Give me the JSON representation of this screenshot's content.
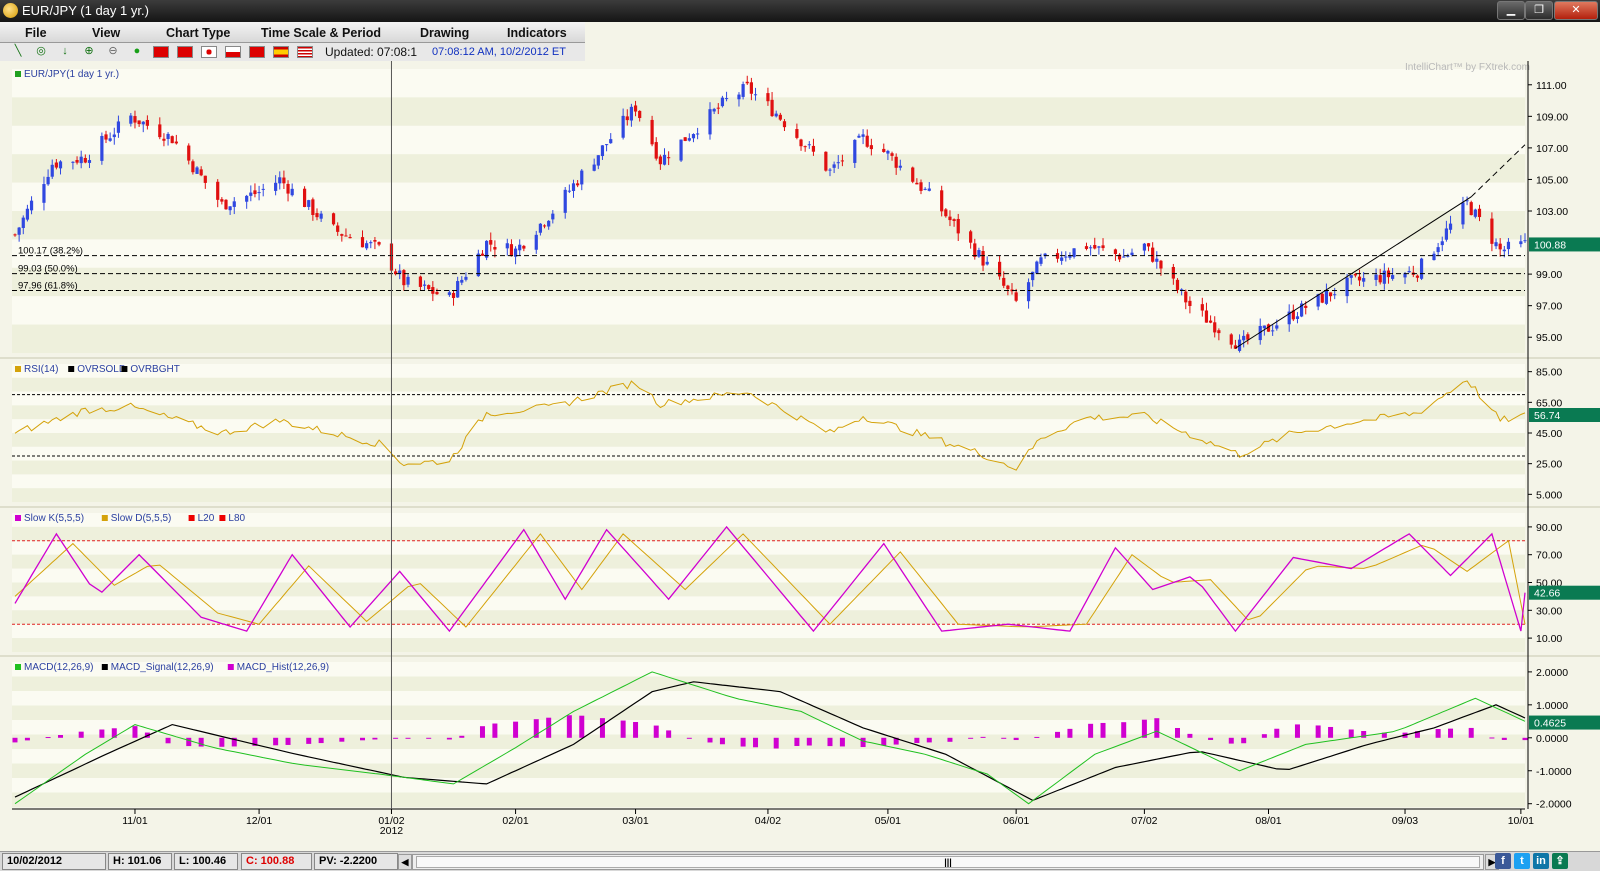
{
  "window": {
    "title": "EUR/JPY (1 day  1 yr.)",
    "min_glyph": "▁",
    "max_glyph": "❐",
    "close_glyph": "✕"
  },
  "menu": [
    "File",
    "View",
    "Chart Type",
    "Time Scale & Period",
    "Drawing",
    "Indicators"
  ],
  "toolbar": {
    "icons": [
      "line-draw-icon",
      "crosshair-icon",
      "arrow-down-icon",
      "zoom-in-icon",
      "zoom-out-icon",
      "green-dot-icon"
    ],
    "flags": [
      "china-flag-icon",
      "hongkong-flag-icon",
      "japan-flag-icon",
      "poland-flag-icon",
      "turkey-flag-icon",
      "spain-flag-icon",
      "usa-flag-icon"
    ],
    "updated_label": "Updated: 07:08:1",
    "updated_time": "07:08:12 AM, 10/2/2012 ET"
  },
  "watermark": "IntelliChart™ by FXtrek.com",
  "colors": {
    "up_candle": "#3048e0",
    "down_candle": "#e01010",
    "rsi": "#d4a20a",
    "slow_k": "#d000d0",
    "slow_d": "#d4a20a",
    "macd": "#20c020",
    "macd_signal": "#000000",
    "macd_hist": "#d000d0",
    "last_value_box": "#0a7a52"
  },
  "xaxis": {
    "labels": [
      "11/01",
      "12/01",
      "01/02",
      "02/01",
      "03/01",
      "04/02",
      "05/01",
      "06/01",
      "07/02",
      "08/01",
      "09/03",
      "10/01"
    ],
    "year_label": "2012"
  },
  "chart_data": [
    {
      "type": "candlestick",
      "legend": [
        "EUR/JPY(1 day  1 yr.)"
      ],
      "x_start": "2011-10-03",
      "x_end": "2012-10-02",
      "ylim": [
        94,
        112
      ],
      "yticks": [
        "111.00",
        "109.00",
        "107.00",
        "105.00",
        "103.00",
        "99.00",
        "97.00",
        "95.00"
      ],
      "last_value": "100.88",
      "anchors": [
        [
          "2011-10-03",
          101.5
        ],
        [
          "2011-10-12",
          106.0
        ],
        [
          "2011-10-20",
          106.4
        ],
        [
          "2011-10-31",
          109.0
        ],
        [
          "2011-11-10",
          107.6
        ],
        [
          "2011-11-22",
          103.4
        ],
        [
          "2011-12-01",
          104.2
        ],
        [
          "2011-12-06",
          105.0
        ],
        [
          "2011-12-19",
          101.8
        ],
        [
          "2011-12-30",
          100.6
        ],
        [
          "2012-01-05",
          98.5
        ],
        [
          "2012-01-16",
          97.5
        ],
        [
          "2012-01-25",
          101.0
        ],
        [
          "2012-02-01",
          100.5
        ],
        [
          "2012-02-10",
          103.0
        ],
        [
          "2012-03-01",
          109.6
        ],
        [
          "2012-03-07",
          106.2
        ],
        [
          "2012-03-23",
          110.0
        ],
        [
          "2012-03-28",
          110.8
        ],
        [
          "2012-04-04",
          109.2
        ],
        [
          "2012-04-17",
          105.5
        ],
        [
          "2012-04-25",
          107.6
        ],
        [
          "2012-05-01",
          106.6
        ],
        [
          "2012-05-11",
          104.0
        ],
        [
          "2012-05-23",
          100.2
        ],
        [
          "2012-06-01",
          97.2
        ],
        [
          "2012-06-07",
          99.8
        ],
        [
          "2012-06-18",
          100.8
        ],
        [
          "2012-06-27",
          100.1
        ],
        [
          "2012-07-02",
          100.8
        ],
        [
          "2012-07-13",
          97.0
        ],
        [
          "2012-07-25",
          94.5
        ],
        [
          "2012-08-07",
          96.5
        ],
        [
          "2012-08-21",
          98.5
        ],
        [
          "2012-09-06",
          99.2
        ],
        [
          "2012-09-18",
          103.5
        ],
        [
          "2012-09-26",
          100.5
        ],
        [
          "2012-10-02",
          100.88
        ]
      ],
      "fib_levels": [
        {
          "label": "100.17 (38.2%)",
          "value": 100.17
        },
        {
          "label": "99.03 (50.0%)",
          "value": 99.03
        },
        {
          "label": "97.96 (61.8%)",
          "value": 97.96
        }
      ],
      "trendline": {
        "from": [
          "2012-07-24",
          94.3
        ],
        "to": [
          "2012-09-19",
          103.9
        ],
        "extend_to": [
          "2012-10-02",
          107.2
        ]
      }
    },
    {
      "type": "line",
      "legend": [
        "RSI(14)",
        "OVRSOLD",
        "OVRBGHT"
      ],
      "ylim": [
        0,
        90
      ],
      "yticks": [
        "85.00",
        "65.00",
        "45.00",
        "25.00",
        "5.000"
      ],
      "levels": [
        70,
        30
      ],
      "last_value": "56.74",
      "anchors": [
        [
          "2011-10-03",
          45
        ],
        [
          "2011-10-20",
          60
        ],
        [
          "2011-10-31",
          62
        ],
        [
          "2011-11-22",
          45
        ],
        [
          "2011-12-06",
          53
        ],
        [
          "2011-12-30",
          38
        ],
        [
          "2012-01-05",
          25
        ],
        [
          "2012-01-16",
          27
        ],
        [
          "2012-01-25",
          58
        ],
        [
          "2012-02-10",
          62
        ],
        [
          "2012-03-01",
          78
        ],
        [
          "2012-03-07",
          64
        ],
        [
          "2012-03-28",
          72
        ],
        [
          "2012-04-17",
          45
        ],
        [
          "2012-04-25",
          56
        ],
        [
          "2012-05-23",
          32
        ],
        [
          "2012-06-01",
          22
        ],
        [
          "2012-06-07",
          42
        ],
        [
          "2012-06-18",
          55
        ],
        [
          "2012-07-02",
          56
        ],
        [
          "2012-07-25",
          31
        ],
        [
          "2012-08-07",
          45
        ],
        [
          "2012-08-21",
          52
        ],
        [
          "2012-09-06",
          58
        ],
        [
          "2012-09-18",
          80
        ],
        [
          "2012-09-26",
          53
        ],
        [
          "2012-10-02",
          56.7
        ]
      ]
    },
    {
      "type": "line",
      "legend": [
        "Slow K(5,5,5)",
        "Slow D(5,5,5)",
        "L20",
        "L80"
      ],
      "ylim": [
        0,
        100
      ],
      "yticks": [
        "90.00",
        "70.00",
        "50.00",
        "30.00",
        "10.00"
      ],
      "levels": [
        80,
        20
      ],
      "last_value": "42.66",
      "k_anchors": [
        [
          "2011-10-03",
          35
        ],
        [
          "2011-10-13",
          85
        ],
        [
          "2011-10-23",
          40
        ],
        [
          "2011-11-02",
          70
        ],
        [
          "2011-11-17",
          25
        ],
        [
          "2011-11-28",
          15
        ],
        [
          "2011-12-09",
          70
        ],
        [
          "2011-12-23",
          18
        ],
        [
          "2012-01-04",
          58
        ],
        [
          "2012-01-16",
          15
        ],
        [
          "2012-02-03",
          88
        ],
        [
          "2012-02-13",
          38
        ],
        [
          "2012-02-23",
          88
        ],
        [
          "2012-03-09",
          38
        ],
        [
          "2012-03-23",
          90
        ],
        [
          "2012-04-13",
          15
        ],
        [
          "2012-04-30",
          78
        ],
        [
          "2012-05-14",
          15
        ],
        [
          "2012-05-30",
          20
        ],
        [
          "2012-06-14",
          15
        ],
        [
          "2012-06-25",
          75
        ],
        [
          "2012-07-04",
          45
        ],
        [
          "2012-07-14",
          55
        ],
        [
          "2012-07-24",
          15
        ],
        [
          "2012-08-07",
          68
        ],
        [
          "2012-08-21",
          60
        ],
        [
          "2012-09-04",
          85
        ],
        [
          "2012-09-14",
          55
        ],
        [
          "2012-09-24",
          85
        ],
        [
          "2012-10-01",
          15
        ],
        [
          "2012-10-02",
          42.66
        ]
      ],
      "d_anchors": [
        [
          "2011-10-03",
          40
        ],
        [
          "2011-10-17",
          78
        ],
        [
          "2011-10-27",
          48
        ],
        [
          "2011-11-06",
          65
        ],
        [
          "2011-11-21",
          28
        ],
        [
          "2011-12-01",
          20
        ],
        [
          "2011-12-13",
          62
        ],
        [
          "2011-12-27",
          22
        ],
        [
          "2012-01-08",
          52
        ],
        [
          "2012-01-20",
          18
        ],
        [
          "2012-02-07",
          85
        ],
        [
          "2012-02-17",
          45
        ],
        [
          "2012-02-27",
          85
        ],
        [
          "2012-03-13",
          45
        ],
        [
          "2012-03-27",
          85
        ],
        [
          "2012-04-17",
          20
        ],
        [
          "2012-05-04",
          72
        ],
        [
          "2012-05-18",
          20
        ],
        [
          "2012-06-03",
          18
        ],
        [
          "2012-06-18",
          20
        ],
        [
          "2012-06-29",
          70
        ],
        [
          "2012-07-08",
          50
        ],
        [
          "2012-07-18",
          52
        ],
        [
          "2012-07-28",
          20
        ],
        [
          "2012-08-11",
          62
        ],
        [
          "2012-08-25",
          60
        ],
        [
          "2012-09-08",
          78
        ],
        [
          "2012-09-18",
          58
        ],
        [
          "2012-09-28",
          80
        ],
        [
          "2012-10-02",
          20
        ]
      ]
    },
    {
      "type": "line+bar",
      "legend": [
        "MACD(12,26,9)",
        "MACD_Signal(12,26,9)",
        "MACD_Hist(12,26,9)"
      ],
      "ylim": [
        -2.1,
        2.3
      ],
      "yticks": [
        "2.0000",
        "1.0000",
        "0.0000",
        "-1.0000",
        "-2.0000"
      ],
      "last_value": "0.4625",
      "macd_anchors": [
        [
          "2011-10-03",
          -2.0
        ],
        [
          "2011-10-20",
          -0.5
        ],
        [
          "2011-11-01",
          0.4
        ],
        [
          "2011-11-20",
          -0.3
        ],
        [
          "2011-12-10",
          -0.8
        ],
        [
          "2011-12-30",
          -1.1
        ],
        [
          "2012-01-17",
          -1.4
        ],
        [
          "2012-02-01",
          -0.3
        ],
        [
          "2012-02-15",
          0.8
        ],
        [
          "2012-03-05",
          2.0
        ],
        [
          "2012-03-25",
          1.2
        ],
        [
          "2012-04-10",
          0.8
        ],
        [
          "2012-04-25",
          -0.1
        ],
        [
          "2012-05-10",
          -0.5
        ],
        [
          "2012-05-25",
          -1.1
        ],
        [
          "2012-06-04",
          -2.0
        ],
        [
          "2012-06-20",
          -0.5
        ],
        [
          "2012-07-05",
          0.2
        ],
        [
          "2012-07-25",
          -1.0
        ],
        [
          "2012-08-10",
          -0.2
        ],
        [
          "2012-09-01",
          0.2
        ],
        [
          "2012-09-20",
          1.2
        ],
        [
          "2012-10-02",
          0.5
        ]
      ],
      "signal_anchors": [
        [
          "2011-10-03",
          -1.8
        ],
        [
          "2011-10-25",
          -0.5
        ],
        [
          "2011-11-10",
          0.4
        ],
        [
          "2011-12-10",
          -0.5
        ],
        [
          "2012-01-05",
          -1.2
        ],
        [
          "2012-01-25",
          -1.4
        ],
        [
          "2012-02-15",
          -0.2
        ],
        [
          "2012-03-05",
          1.4
        ],
        [
          "2012-03-15",
          1.7
        ],
        [
          "2012-04-05",
          1.4
        ],
        [
          "2012-04-25",
          0.3
        ],
        [
          "2012-05-15",
          -0.5
        ],
        [
          "2012-06-05",
          -1.9
        ],
        [
          "2012-06-25",
          -0.9
        ],
        [
          "2012-07-15",
          -0.4
        ],
        [
          "2012-08-05",
          -1.0
        ],
        [
          "2012-08-25",
          -0.2
        ],
        [
          "2012-09-10",
          0.3
        ],
        [
          "2012-09-25",
          1.0
        ],
        [
          "2012-10-02",
          0.6
        ]
      ]
    }
  ],
  "statusbar": {
    "date": "10/02/2012",
    "high": "H: 101.06",
    "low": "L: 100.46",
    "close": "C: 100.88",
    "pv": "PV: -2.2200",
    "scroll_grip": "|||"
  },
  "social": [
    "facebook-icon",
    "twitter-icon",
    "linkedin-icon",
    "share-icon"
  ]
}
